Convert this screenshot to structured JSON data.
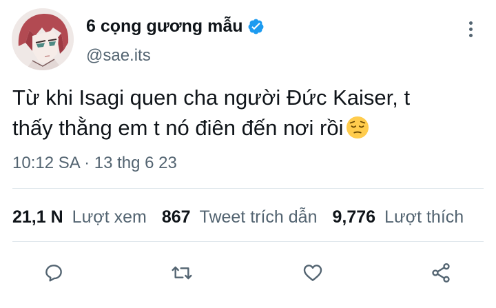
{
  "user": {
    "display_name": "6 cọng gương mẫu",
    "handle": "@sae.its",
    "verified": true,
    "avatar_icon": "anime-avatar"
  },
  "tweet": {
    "text_line1": "Từ khi Isagi quen cha người Đức Kaiser, t",
    "text_line2": "thấy thằng em t nó điên đến nơi rồi",
    "emoji": "pensive-face",
    "timestamp": "10:12 SA · 13 thg 6 23"
  },
  "stats": [
    {
      "value": "21,1 N",
      "label": "Lượt xem"
    },
    {
      "value": "867",
      "label": "Tweet trích dẫn"
    },
    {
      "value": "9,776",
      "label": "Lượt thích"
    }
  ],
  "actions": [
    "reply-icon",
    "retweet-icon",
    "like-icon",
    "share-icon"
  ],
  "colors": {
    "text": "#0f1419",
    "secondary": "#536471",
    "verified": "#1d9bf0",
    "divider": "#e1e8ed"
  }
}
